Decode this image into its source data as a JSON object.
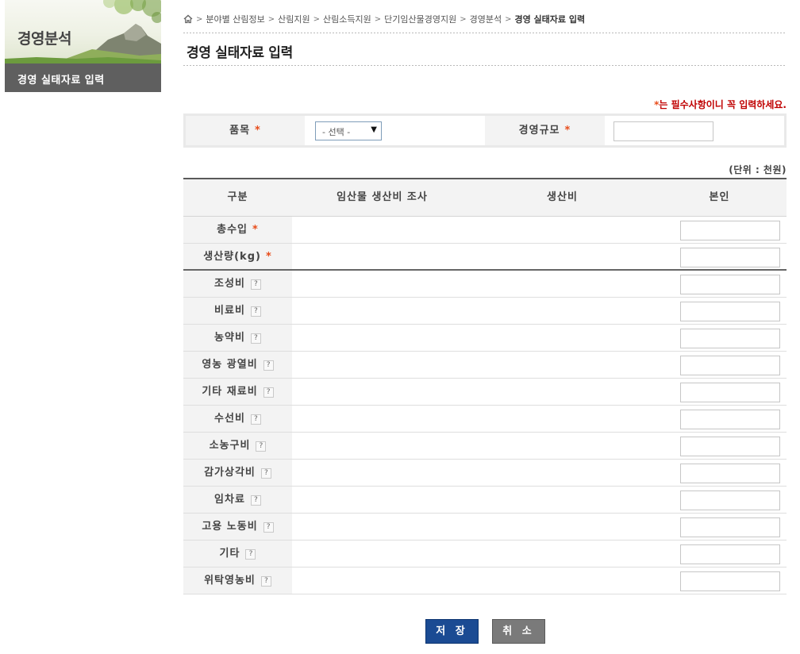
{
  "sidebar": {
    "title": "경영분석",
    "menu_item": "경영 실태자료 입력"
  },
  "breadcrumb": {
    "items": [
      "분야별 산림정보",
      "산림지원",
      "산림소득지원",
      "단기임산물경영지원",
      "경영분석",
      "경영 실태자료 입력"
    ]
  },
  "page_title": "경영 실태자료 입력",
  "required_note": {
    "star": "*",
    "text": "는 필수사항이니 꼭 입력하세요."
  },
  "top_form": {
    "item_label": "품목",
    "item_select_value": "- 선택 -",
    "scale_label": "경영규모",
    "required_mark": "*"
  },
  "unit_note": "(단위 : 천원)",
  "table": {
    "headers": [
      "구분",
      "임산물 생산비 조사",
      "생산비",
      "본인"
    ],
    "rows": [
      {
        "label": "총수입",
        "required": true,
        "help": false
      },
      {
        "label": "생산량(kg)",
        "required": true,
        "help": false
      },
      {
        "label": "조성비",
        "required": false,
        "help": true
      },
      {
        "label": "비료비",
        "required": false,
        "help": true
      },
      {
        "label": "농약비",
        "required": false,
        "help": true
      },
      {
        "label": "영농 광열비",
        "required": false,
        "help": true
      },
      {
        "label": "기타 재료비",
        "required": false,
        "help": true
      },
      {
        "label": "수선비",
        "required": false,
        "help": true
      },
      {
        "label": "소농구비",
        "required": false,
        "help": true
      },
      {
        "label": "감가상각비",
        "required": false,
        "help": true
      },
      {
        "label": "임차료",
        "required": false,
        "help": true
      },
      {
        "label": "고용 노동비",
        "required": false,
        "help": true
      },
      {
        "label": "기타",
        "required": false,
        "help": true
      },
      {
        "label": "위탁영농비",
        "required": false,
        "help": true
      }
    ],
    "help_glyph": "?"
  },
  "buttons": {
    "save": "저 장",
    "cancel": "취 소"
  },
  "colors": {
    "required_star": "#e84c1a",
    "required_note": "#c00000",
    "save_button": "#1b4b93",
    "cancel_button": "#7a7a7a",
    "side_menu": "#5f5f5f"
  },
  "icons": {
    "home": "home-icon",
    "separator": "chevron-right-icon",
    "select_arrow": "dropdown-arrow-icon",
    "help": "question-icon"
  }
}
